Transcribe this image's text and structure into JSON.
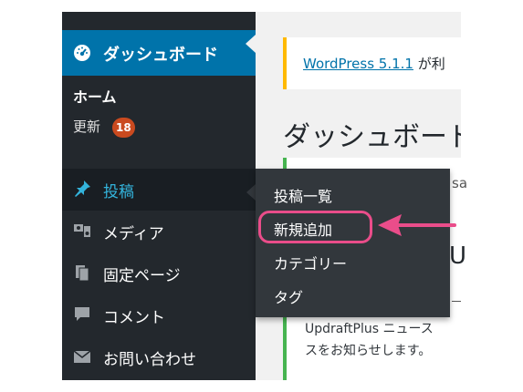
{
  "sidebar": {
    "dashboard_label": "ダッシュボード",
    "home_label": "ホーム",
    "updates_label": "更新",
    "updates_count": "18",
    "items": [
      {
        "label": "投稿",
        "icon": "pin-icon"
      },
      {
        "label": "メディア",
        "icon": "media-icon"
      },
      {
        "label": "固定ページ",
        "icon": "pages-icon"
      },
      {
        "label": "コメント",
        "icon": "comment-icon"
      },
      {
        "label": "お問い合わせ",
        "icon": "mail-icon"
      }
    ]
  },
  "flyout": {
    "items": [
      "投稿一覧",
      "新規追加",
      "カテゴリー",
      "タグ"
    ],
    "highlighted": "新規追加"
  },
  "main": {
    "notice_link": "WordPress 5.1.1",
    "notice_rest": " が利",
    "title": "ダッシュボード",
    "partial_a": "sa",
    "partial_u": "U",
    "box_line1": "UpdraftPlus ニュース",
    "box_line2": "スをお知らせします。"
  },
  "colors": {
    "sidebar_bg": "#23282d",
    "accent_blue": "#0073aa",
    "active_text": "#33b3db",
    "badge": "#ca4a1f",
    "highlight_ring": "#ea4d8a",
    "notice_border": "#ffb900",
    "box_border": "#46b450"
  }
}
